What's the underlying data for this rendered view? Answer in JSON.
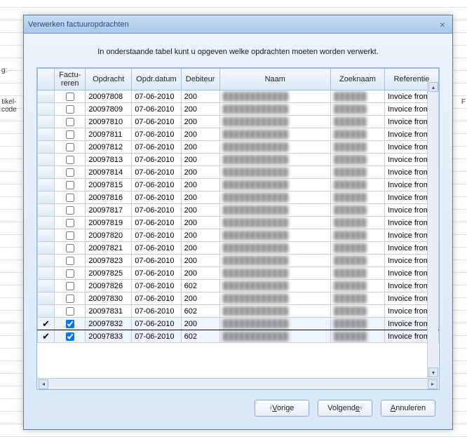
{
  "background": {
    "label_left_1": "g:",
    "label_left_2": "tikel-\ncode",
    "label_right": "F"
  },
  "dialog": {
    "title": "Verwerken factuuropdrachten",
    "close_icon": "×",
    "intro": "In onderstaande tabel kunt u opgeven welke opdrachten moeten worden verwerkt."
  },
  "table": {
    "headers": {
      "mark": "",
      "factureren": "Factu-\nreren",
      "opdracht": "Opdracht",
      "opdrdatum": "Opdr.datum",
      "debiteur": "Debiteur",
      "naam": "Naam",
      "zoeknaam": "Zoeknaam",
      "referentie": "Referentie"
    },
    "rows": [
      {
        "mark": "",
        "checked": false,
        "opdracht": "20097808",
        "datum": "07-06-2010",
        "debiteur": "200",
        "naam": "████████████",
        "zoek": "██████",
        "ref": "Invoice from"
      },
      {
        "mark": "",
        "checked": false,
        "opdracht": "20097809",
        "datum": "07-06-2010",
        "debiteur": "200",
        "naam": "████████████",
        "zoek": "██████",
        "ref": "Invoice from"
      },
      {
        "mark": "",
        "checked": false,
        "opdracht": "20097810",
        "datum": "07-06-2010",
        "debiteur": "200",
        "naam": "████████████",
        "zoek": "██████",
        "ref": "Invoice from"
      },
      {
        "mark": "",
        "checked": false,
        "opdracht": "20097811",
        "datum": "07-06-2010",
        "debiteur": "200",
        "naam": "████████████",
        "zoek": "██████",
        "ref": "Invoice from"
      },
      {
        "mark": "",
        "checked": false,
        "opdracht": "20097812",
        "datum": "07-06-2010",
        "debiteur": "200",
        "naam": "████████████",
        "zoek": "██████",
        "ref": "Invoice from"
      },
      {
        "mark": "",
        "checked": false,
        "opdracht": "20097813",
        "datum": "07-06-2010",
        "debiteur": "200",
        "naam": "████████████",
        "zoek": "██████",
        "ref": "Invoice from"
      },
      {
        "mark": "",
        "checked": false,
        "opdracht": "20097814",
        "datum": "07-06-2010",
        "debiteur": "200",
        "naam": "████████████",
        "zoek": "██████",
        "ref": "Invoice from"
      },
      {
        "mark": "",
        "checked": false,
        "opdracht": "20097815",
        "datum": "07-06-2010",
        "debiteur": "200",
        "naam": "████████████",
        "zoek": "██████",
        "ref": "Invoice from"
      },
      {
        "mark": "",
        "checked": false,
        "opdracht": "20097816",
        "datum": "07-06-2010",
        "debiteur": "200",
        "naam": "████████████",
        "zoek": "██████",
        "ref": "Invoice from"
      },
      {
        "mark": "",
        "checked": false,
        "opdracht": "20097817",
        "datum": "07-06-2010",
        "debiteur": "200",
        "naam": "████████████",
        "zoek": "██████",
        "ref": "Invoice from"
      },
      {
        "mark": "",
        "checked": false,
        "opdracht": "20097819",
        "datum": "07-06-2010",
        "debiteur": "200",
        "naam": "████████████",
        "zoek": "██████",
        "ref": "Invoice from"
      },
      {
        "mark": "",
        "checked": false,
        "opdracht": "20097820",
        "datum": "07-06-2010",
        "debiteur": "200",
        "naam": "████████████",
        "zoek": "██████",
        "ref": "Invoice from"
      },
      {
        "mark": "",
        "checked": false,
        "opdracht": "20097821",
        "datum": "07-06-2010",
        "debiteur": "200",
        "naam": "████████████",
        "zoek": "██████",
        "ref": "Invoice from"
      },
      {
        "mark": "",
        "checked": false,
        "opdracht": "20097823",
        "datum": "07-06-2010",
        "debiteur": "200",
        "naam": "████████████",
        "zoek": "██████",
        "ref": "Invoice from"
      },
      {
        "mark": "",
        "checked": false,
        "opdracht": "20097825",
        "datum": "07-06-2010",
        "debiteur": "200",
        "naam": "████████████",
        "zoek": "██████",
        "ref": "Invoice from"
      },
      {
        "mark": "",
        "checked": false,
        "opdracht": "20097826",
        "datum": "07-06-2010",
        "debiteur": "602",
        "naam": "████████████",
        "zoek": "██████",
        "ref": "Invoice from"
      },
      {
        "mark": "",
        "checked": false,
        "opdracht": "20097830",
        "datum": "07-06-2010",
        "debiteur": "200",
        "naam": "████████████",
        "zoek": "██████",
        "ref": "Invoice from"
      },
      {
        "mark": "",
        "checked": false,
        "opdracht": "20097831",
        "datum": "07-06-2010",
        "debiteur": "602",
        "naam": "████████████",
        "zoek": "██████",
        "ref": "Invoice from"
      },
      {
        "mark": "✔",
        "checked": true,
        "opdracht": "20097832",
        "datum": "07-06-2010",
        "debiteur": "200",
        "naam": "████████████",
        "zoek": "██████",
        "ref": "Invoice from",
        "strong": true
      },
      {
        "mark": "✔",
        "checked": true,
        "opdracht": "20097833",
        "datum": "07-06-2010",
        "debiteur": "602",
        "naam": "████████████",
        "zoek": "██████",
        "ref": "Invoice from"
      }
    ]
  },
  "buttons": {
    "prev_prefix": "V",
    "prev_rest": "orige",
    "next_prefix": "Volgend",
    "next_accel": "e",
    "cancel_accel": "A",
    "cancel_rest": "nnuleren"
  }
}
